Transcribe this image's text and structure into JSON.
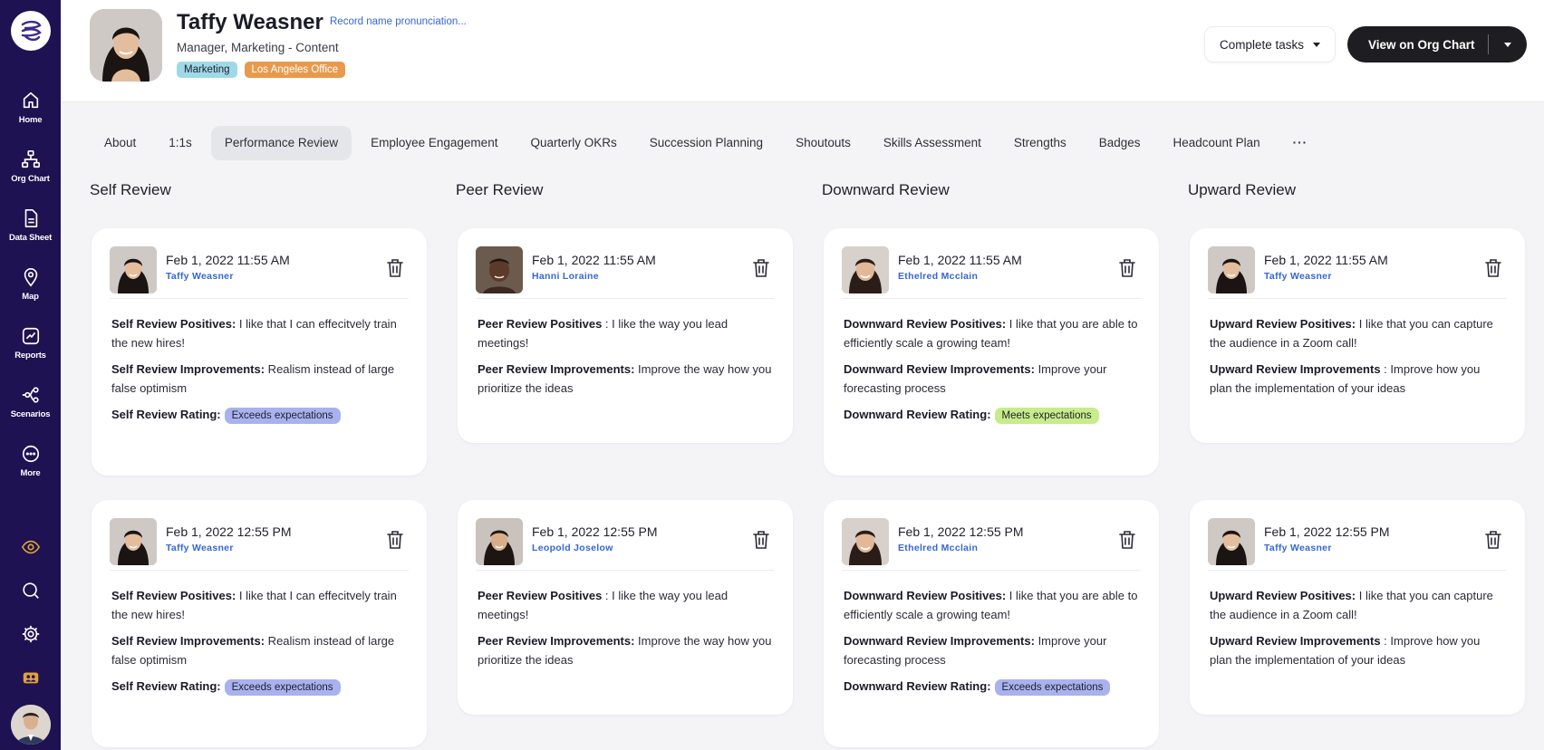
{
  "sidebar": {
    "items": [
      {
        "label": "Home",
        "icon": "home-icon"
      },
      {
        "label": "Org Chart",
        "icon": "org-chart-icon"
      },
      {
        "label": "Data Sheet",
        "icon": "data-sheet-icon"
      },
      {
        "label": "Map",
        "icon": "map-pin-icon"
      },
      {
        "label": "Reports",
        "icon": "reports-icon"
      },
      {
        "label": "Scenarios",
        "icon": "scenarios-icon"
      },
      {
        "label": "More",
        "icon": "more-icon"
      }
    ],
    "accent": "#1e1252"
  },
  "header": {
    "name": "Taffy Weasner",
    "pronunciation_link": "Record name pronunciation...",
    "job_title": "Manager, Marketing - Content",
    "tags": [
      "Marketing",
      "Los Angeles Office"
    ],
    "complete_tasks": "Complete tasks",
    "view_org_chart": "View on Org Chart"
  },
  "tabs": [
    {
      "label": "About"
    },
    {
      "label": "1:1s"
    },
    {
      "label": "Performance Review",
      "active": true
    },
    {
      "label": "Employee Engagement"
    },
    {
      "label": "Quarterly OKRs"
    },
    {
      "label": "Succession Planning"
    },
    {
      "label": "Shoutouts"
    },
    {
      "label": "Skills Assessment"
    },
    {
      "label": "Strengths"
    },
    {
      "label": "Badges"
    },
    {
      "label": "Headcount Plan"
    },
    {
      "label": "···"
    }
  ],
  "columns": [
    {
      "title": "Self Review",
      "cards": [
        {
          "date": "Feb 1, 2022 11:55 AM",
          "author": "Taffy Weasner",
          "positives_label": "Self Review Positives:",
          "positives": " I like that I can effecitvely train the new hires!",
          "improvements_label": "Self Review Improvements:",
          "improvements": " Realism instead of large false optimism",
          "rating_label": "Self Review Rating:",
          "rating": "Exceeds expectations"
        },
        {
          "date": "Feb 1, 2022 12:55 PM",
          "author": "Taffy Weasner",
          "positives_label": "Self Review Positives:",
          "positives": " I like that I can effecitvely train the new hires!",
          "improvements_label": "Self Review Improvements:",
          "improvements": " Realism instead of large false optimism",
          "rating_label": "Self Review Rating:",
          "rating": "Exceeds expectations"
        }
      ]
    },
    {
      "title": "Peer Review",
      "cards": [
        {
          "date": "Feb 1, 2022 11:55 AM",
          "author": "Hanni Loraine",
          "positives_label": "Peer Review Positives",
          "positives": " : I like the way you lead meetings!",
          "improvements_label": "Peer Review Improvements:",
          "improvements": " Improve the way how you prioritize the ideas"
        },
        {
          "date": "Feb 1, 2022 12:55 PM",
          "author": "Leopold Joselow",
          "positives_label": "Peer Review Positives",
          "positives": " : I like the way you lead meetings!",
          "improvements_label": "Peer Review Improvements:",
          "improvements": " Improve the way how you prioritize the ideas"
        }
      ]
    },
    {
      "title": "Downward Review",
      "cards": [
        {
          "date": "Feb 1, 2022 11:55 AM",
          "author": "Ethelred Mcclain",
          "positives_label": "Downward Review Positives:",
          "positives": " I like that you are able to efficiently scale a growing team!",
          "improvements_label": "Downward Review Improvements:",
          "improvements": " Improve your forecasting process",
          "rating_label": "Downward Review Rating:",
          "rating": "Meets expectations"
        },
        {
          "date": "Feb 1, 2022 12:55 PM",
          "author": "Ethelred Mcclain",
          "positives_label": "Downward Review Positives:",
          "positives": " I like that you are able to efficiently scale a growing team!",
          "improvements_label": "Downward Review Improvements:",
          "improvements": " Improve your forecasting process",
          "rating_label": "Downward Review Rating:",
          "rating": "Exceeds expectations"
        }
      ]
    },
    {
      "title": "Upward Review",
      "cards": [
        {
          "date": "Feb 1, 2022 11:55 AM",
          "author": "Taffy Weasner",
          "positives_label": "Upward Review Positives:",
          "positives": " I like that you can capture the audience in a Zoom call!",
          "improvements_label": "Upward Review Improvements",
          "improvements": " : Improve how you plan the implementation of your ideas"
        },
        {
          "date": "Feb 1, 2022 12:55 PM",
          "author": "Taffy Weasner",
          "positives_label": "Upward Review Positives:",
          "positives": " I like that you can capture the audience in a Zoom call!",
          "improvements_label": "Upward Review Improvements",
          "improvements": " : Improve how you plan the implementation of your ideas"
        }
      ]
    }
  ],
  "colors": {
    "link": "#3566d6",
    "exceeds_badge": "#a9b2ef",
    "meets_badge": "#c7ec8a",
    "tag_marketing": "#9fd9e8",
    "tag_office": "#e79a4e"
  }
}
